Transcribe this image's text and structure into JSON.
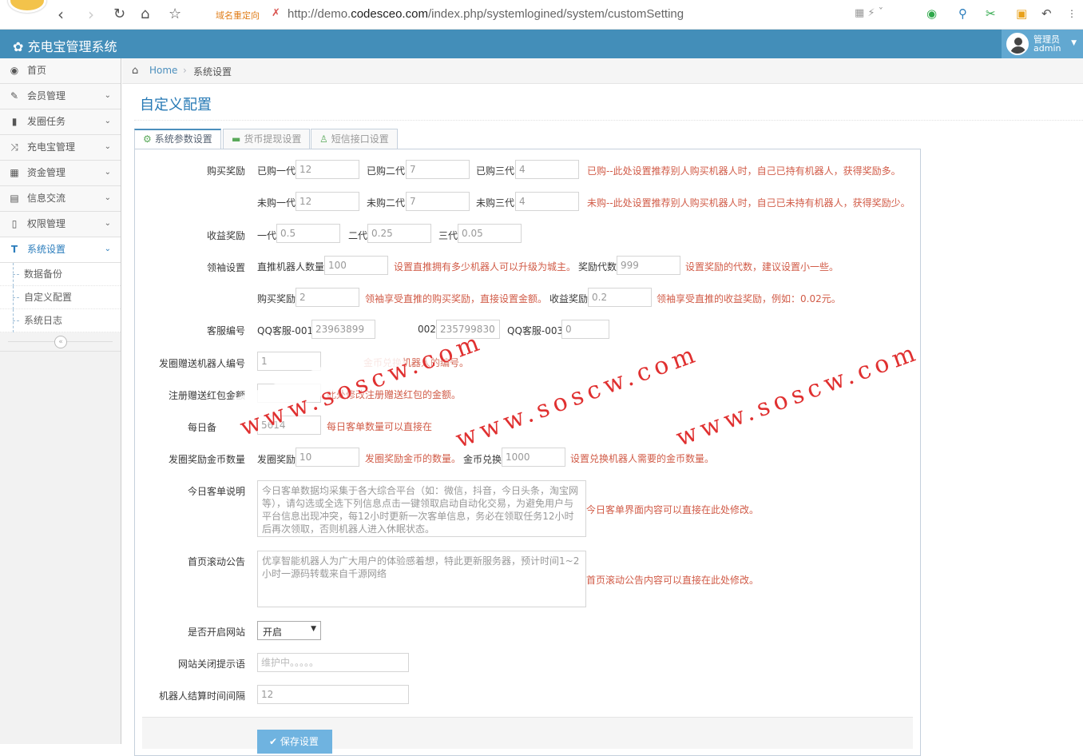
{
  "browser": {
    "redirect_label": "域名重定向",
    "url_prefix": "http://demo.",
    "url_domain": "codesceo.com",
    "url_path": "/index.php/systemlogined/system/customSetting"
  },
  "app": {
    "title": "充电宝管理系统",
    "user_role": "管理员",
    "user_name": "admin"
  },
  "sidebar": {
    "items": [
      {
        "label": "首页",
        "icon": "dashboard-icon"
      },
      {
        "label": "会员管理",
        "icon": "edit-icon"
      },
      {
        "label": "发圈任务",
        "icon": "book-icon"
      },
      {
        "label": "充电宝管理",
        "icon": "shuffle-icon"
      },
      {
        "label": "资金管理",
        "icon": "calendar-icon"
      },
      {
        "label": "信息交流",
        "icon": "list-icon"
      },
      {
        "label": "权限管理",
        "icon": "file-icon"
      },
      {
        "label": "系统设置",
        "icon": "text-icon"
      }
    ],
    "subitems": [
      "数据备份",
      "自定义配置",
      "系统日志"
    ]
  },
  "breadcrumb": {
    "home": "Home",
    "current": "系统设置"
  },
  "page": {
    "title": "自定义配置"
  },
  "tabs": [
    "系统参数设置",
    "货币提现设置",
    "短信接口设置"
  ],
  "form": {
    "buy_reward": {
      "label": "购买奖励",
      "bought1_label": "已购一代",
      "bought1": "12",
      "bought2_label": "已购二代",
      "bought2": "7",
      "bought3_label": "已购三代",
      "bought3": "4",
      "bought_hint": "已购--此处设置推荐别人购买机器人时，自己已持有机器人，获得奖励多。",
      "unbought1_label": "未购一代",
      "unbought1": "12",
      "unbought2_label": "未购二代",
      "unbought2": "7",
      "unbought3_label": "未购三代",
      "unbought3": "4",
      "unbought_hint": "未购--此处设置推荐别人购买机器人时，自己已未持有机器人，获得奖励少。"
    },
    "income_reward": {
      "label": "收益奖励",
      "g1_label": "一代",
      "g1": "0.5",
      "g2_label": "二代",
      "g2": "0.25",
      "g3_label": "三代",
      "g3": "0.05"
    },
    "leader": {
      "label": "领袖设置",
      "direct_label": "直推机器人数量",
      "direct": "100",
      "direct_hint": "设置直推拥有多少机器人可以升级为城主。",
      "gen_label": "奖励代数",
      "gen": "999",
      "gen_hint": "设置奖励的代数，建议设置小一些。",
      "buy_label": "购买奖励",
      "buy": "2",
      "buy_hint": "领袖享受直推的购买奖励，直接设置金额。",
      "income_label": "收益奖励",
      "income": "0.2",
      "income_hint": "领袖享受直推的收益奖励，例如：0.02元。"
    },
    "service": {
      "label": "客服编号",
      "qq1_label": "QQ客服-001",
      "qq1": "23963899",
      "qq2_label": "002",
      "qq2": "235799830",
      "qq3_label": "QQ客服-003",
      "qq3": "0"
    },
    "gift_robot": {
      "label": "发圈赠送机器人编号",
      "value": "1",
      "hint": "金币兑换机器人的编号。"
    },
    "reg_bonus": {
      "label": "注册赠送红包金额",
      "value": "",
      "hint": "此处修改注册赠送红包的金额。"
    },
    "daily": {
      "label": "每日备",
      "value": "5614",
      "hint": "每日客单数量可以直接在"
    },
    "coins": {
      "label": "发圈奖励金币数量",
      "reward_label": "发圈奖励",
      "reward": "10",
      "reward_hint": "发圈奖励金币的数量。",
      "exchange_label": "金币兑换",
      "exchange": "1000",
      "exchange_hint": "设置兑换机器人需要的金币数量。"
    },
    "today_desc": {
      "label": "今日客单说明",
      "value": "今日客单数据均采集于各大综合平台（如：微信，抖音，今日头条，淘宝网等），请勾选或全选下列信息点击一键领取启动自动化交易，为避免用户与平台信息出现冲突，每12小时更新一次客单信息，务必在领取任务12小时后再次领取，否则机器人进入休眠状态。",
      "hint": "今日客单界面内容可以直接在此处修改。"
    },
    "notice": {
      "label": "首页滚动公告",
      "value": "优享智能机器人为广大用户的体验感着想，特此更新服务器，预计时间1~2小时一源码转载来自千源网络",
      "hint": "首页滚动公告内容可以直接在此处修改。"
    },
    "site_open": {
      "label": "是否开启网站",
      "value": "开启"
    },
    "close_tip": {
      "label": "网站关闭提示语",
      "placeholder": "维护中。。。。。"
    },
    "settle": {
      "label": "机器人结算时间间隔",
      "value": "12"
    },
    "save_label": "保存设置"
  },
  "watermark": "www.soscw.com"
}
